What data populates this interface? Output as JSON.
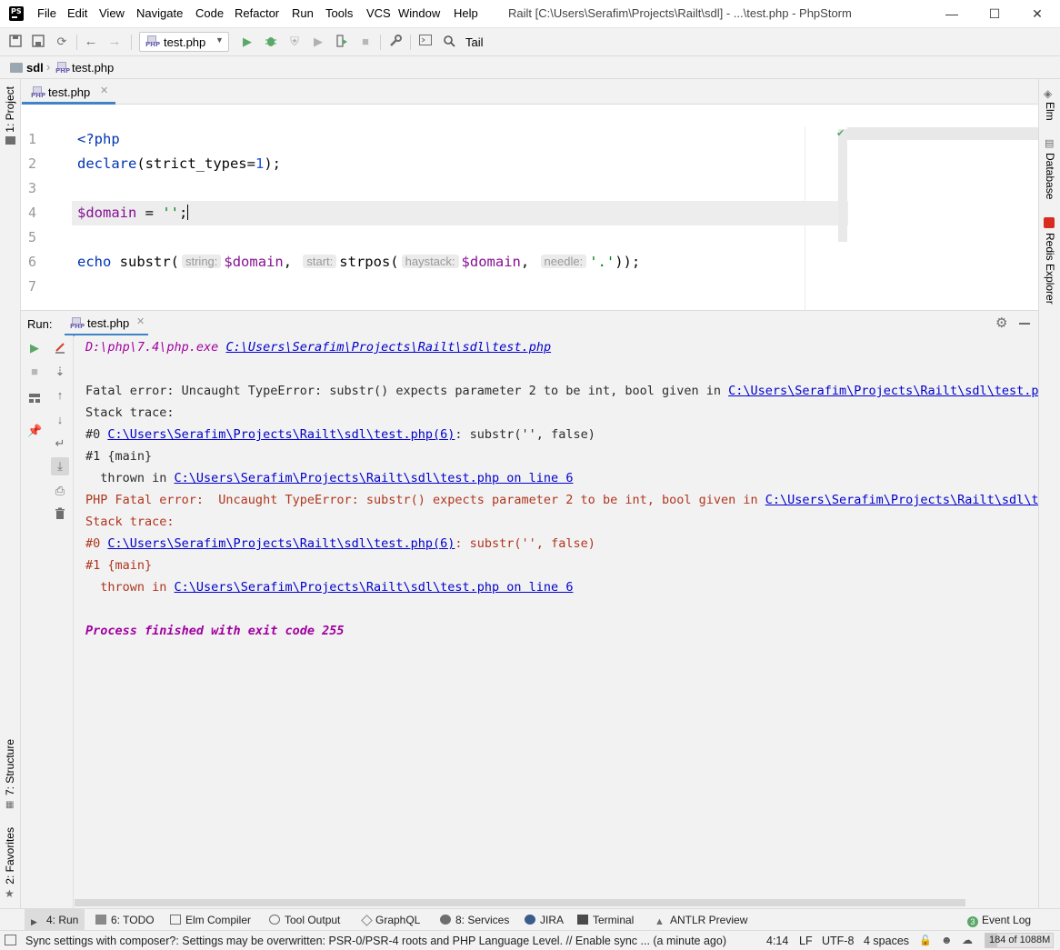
{
  "titlebar": {
    "app_logo": "PS",
    "menu": [
      "File",
      "Edit",
      "View",
      "Navigate",
      "Code",
      "Refactor",
      "Run",
      "Tools",
      "VCS",
      "Window",
      "Help"
    ],
    "window_title": "Railt [C:\\Users\\Serafim\\Projects\\Railt\\sdl] - ...\\test.php - PhpStorm",
    "controls": [
      "—",
      "☐",
      "✕"
    ]
  },
  "toolbar": {
    "run_config": "test.php",
    "tail_label": "Tail",
    "icons": [
      "save-all-icon",
      "save-icon",
      "sync-icon",
      "back-icon",
      "forward-icon",
      "run-icon",
      "debug-icon",
      "coverage-icon",
      "profile-icon",
      "run-test-icon",
      "stop-icon",
      "settings-wrench-icon",
      "terminal-window-icon",
      "search-icon"
    ]
  },
  "breadcrumb": {
    "items": [
      "sdl",
      "test.php"
    ]
  },
  "left_strip": {
    "top": "1: Project",
    "bottom": [
      "7: Structure",
      "2: Favorites"
    ]
  },
  "right_strip": {
    "items": [
      "Elm",
      "Database",
      "Redis Explorer"
    ]
  },
  "editor": {
    "tab_label": "test.php",
    "line_numbers": [
      "1",
      "2",
      "3",
      "4",
      "5",
      "6",
      "7"
    ],
    "lines": {
      "l1": "<?php",
      "l2_kw": "declare",
      "l2_open": "(strict_types=",
      "l2_num": "1",
      "l2_close": ");",
      "l4_var": "$domain",
      "l4_eq": " = ",
      "l4_str": "''",
      "l4_end": ";",
      "l6_echo": "echo",
      "l6_fn": " substr(",
      "l6_hint1": "string:",
      "l6_var1": "$domain",
      "l6_comma1": ", ",
      "l6_hint2": "start:",
      "l6_fn2": "strpos(",
      "l6_hint3": "haystack:",
      "l6_var2": "$domain",
      "l6_comma2": ", ",
      "l6_hint4": "needle:",
      "l6_str": "'.'",
      "l6_end": "));"
    }
  },
  "run_panel": {
    "run_label": "Run:",
    "tab_label": "test.php",
    "console": {
      "cmd_exe": "D:\\php\\7.4\\php.exe",
      "cmd_file": "C:\\Users\\Serafim\\Projects\\Railt\\sdl\\test.php",
      "fatal1_text": "Fatal error: Uncaught TypeError: substr() expects parameter 2 to be int, bool given in ",
      "fatal1_link": "C:\\Users\\Serafim\\Projects\\Railt\\sdl\\test.php",
      "stack1": "Stack trace:",
      "frame0_prefix": "#0 ",
      "frame0_link": "C:\\Users\\Serafim\\Projects\\Railt\\sdl\\test.php(6)",
      "frame0_suffix": ": substr('', false)",
      "frame1": "#1 {main}",
      "thrown_prefix": "  thrown in ",
      "thrown_link": "C:\\Users\\Serafim\\Projects\\Railt\\sdl\\test.php on line 6",
      "php_fatal_text": "PHP Fatal error:  Uncaught TypeError: substr() expects parameter 2 to be int, bool given in ",
      "php_fatal_link": "C:\\Users\\Serafim\\Projects\\Railt\\sdl\\tes",
      "stack2": "Stack trace:",
      "err_frame0_prefix": "#0 ",
      "err_frame0_link": "C:\\Users\\Serafim\\Projects\\Railt\\sdl\\test.php(6)",
      "err_frame0_suffix": ": substr('', false)",
      "err_frame1": "#1 {main}",
      "err_thrown_prefix": "  thrown in ",
      "err_thrown_link": "C:\\Users\\Serafim\\Projects\\Railt\\sdl\\test.php on line 6",
      "exit": "Process finished with exit code 255"
    }
  },
  "tool_windows": [
    {
      "label": "4: Run",
      "icon": "run-triangle-icon"
    },
    {
      "label": "6: TODO",
      "icon": "todo-list-icon"
    },
    {
      "label": "Elm Compiler",
      "icon": "elm-icon"
    },
    {
      "label": "Tool Output",
      "icon": "tool-output-icon"
    },
    {
      "label": "GraphQL",
      "icon": "graphql-icon"
    },
    {
      "label": "8: Services",
      "icon": "services-icon"
    },
    {
      "label": "JIRA",
      "icon": "jira-icon"
    },
    {
      "label": "Terminal",
      "icon": "terminal-icon"
    },
    {
      "label": "ANTLR Preview",
      "icon": "antlr-icon"
    }
  ],
  "event_log": {
    "label": "Event Log",
    "count": "3"
  },
  "status_bar": {
    "message": "Sync settings with composer?: Settings may be overwritten: PSR-0/PSR-4 roots and PHP Language Level. // Enable sync ... (a minute ago)",
    "position": "4:14",
    "line_sep": "LF",
    "encoding": "UTF-8",
    "indent": "4 spaces",
    "memory": "184 of 1088M",
    "memory_fraction": 0.17
  },
  "colors": {
    "accent": "#4083c9",
    "keyword": "#0033b3",
    "variable": "#871094",
    "string": "#067d17",
    "number": "#1750eb",
    "error": "#b0361f",
    "link": "#0000cc",
    "process_purple": "#a000a0",
    "run_green": "#59a869"
  }
}
